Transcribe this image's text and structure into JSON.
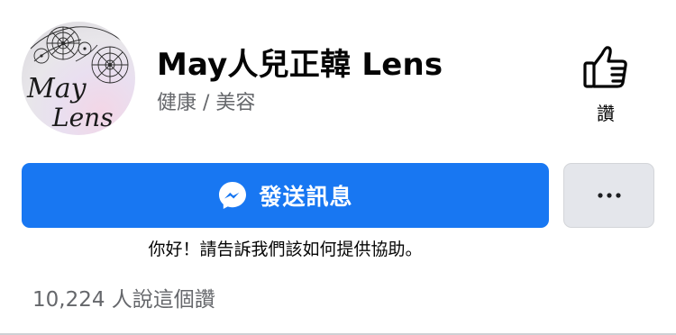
{
  "profile": {
    "avatar_text_line1": "May",
    "avatar_text_line2": "Lens",
    "name": "May人兒正韓 Lens",
    "category": "健康 / 美容"
  },
  "like": {
    "icon": "thumbs-up-icon",
    "label": "讚"
  },
  "actions": {
    "message_icon": "messenger-icon",
    "message_label": "發送訊息",
    "more_icon": "more-dots-icon"
  },
  "greeting": "你好！請告訴我們該如何提供協助。",
  "likes_summary": "10,224 人說這個讚",
  "colors": {
    "primary_blue": "#1877f2",
    "secondary_text": "#65676b",
    "more_button_bg": "#e4e6eb"
  }
}
